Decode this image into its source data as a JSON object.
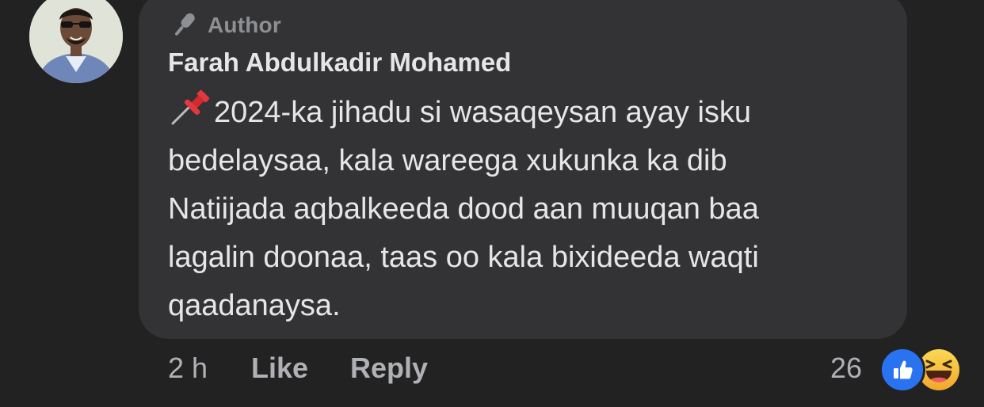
{
  "comment": {
    "author_badge": "Author",
    "author_name": "Farah Abdulkadir Mohamed",
    "text_lines": [
      "2024-ka jihadu si wasaqeysan ayay isku",
      "bedelaysaa, kala wareega xukunka ka dib",
      "Natiijada aqbalkeeda dood aan muuqan baa",
      "lagalin doonaa, taas oo kala bixideeda waqti",
      "qaadanaysa."
    ],
    "leading_icon": "pushpin-icon"
  },
  "actions": {
    "time": "2 h",
    "like_label": "Like",
    "reply_label": "Reply"
  },
  "reactions": {
    "count": "26",
    "types": [
      "like-icon",
      "haha-icon"
    ],
    "like_color": "#2a73f0",
    "haha_color": "#f7c33f"
  },
  "colors": {
    "background": "#222223",
    "bubble": "#333335",
    "text": "#e6e6e7",
    "muted": "#b0b1b5"
  }
}
